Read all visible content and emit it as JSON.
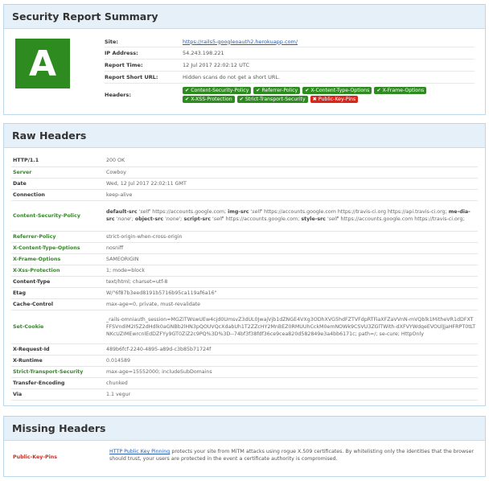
{
  "summary": {
    "title": "Security Report Summary",
    "grade": "A",
    "grade_color": "#2e8b1f",
    "rows": {
      "site_label": "Site:",
      "site_value": "https://rails5-googleoauth2.herokuapp.com/",
      "ip_label": "IP Address:",
      "ip_value": "54.243.198.221",
      "time_label": "Report Time:",
      "time_value": "12 Jul 2017 22:02:12 UTC",
      "short_label": "Report Short URL:",
      "short_value": "Hidden scans do not get a short URL.",
      "headers_label": "Headers:"
    },
    "badges": [
      {
        "label": "Content-Security-Policy",
        "status": "good",
        "icon": "check-icon"
      },
      {
        "label": "Referrer-Policy",
        "status": "good",
        "icon": "check-icon"
      },
      {
        "label": "X-Content-Type-Options",
        "status": "good",
        "icon": "check-icon"
      },
      {
        "label": "X-Frame-Options",
        "status": "good",
        "icon": "check-icon"
      },
      {
        "label": "X-XSS-Protection",
        "status": "good",
        "icon": "check-icon"
      },
      {
        "label": "Strict-Transport-Security",
        "status": "good",
        "icon": "check-icon"
      },
      {
        "label": "Public-Key-Pins",
        "status": "bad",
        "icon": "cross-icon"
      }
    ],
    "colors": {
      "good": "#2e8b1f",
      "bad": "#d9261c",
      "link": "#2a5db0",
      "panel_head": "#e6f0f8"
    }
  },
  "raw": {
    "title": "Raw Headers",
    "rows": [
      {
        "k": "HTTP/1.1",
        "v": "200 OK",
        "green": false
      },
      {
        "k": "Server",
        "v": "Cowboy",
        "green": true
      },
      {
        "k": "Date",
        "v": "Wed, 12 Jul 2017 22:02:11 GMT",
        "green": false
      },
      {
        "k": "Connection",
        "v": "keep-alive",
        "green": false
      },
      {
        "k": "Content-Security-Policy",
        "v": "",
        "green": true
      },
      {
        "k": "Referrer-Policy",
        "v": "strict-origin-when-cross-origin",
        "green": true
      },
      {
        "k": "X-Content-Type-Options",
        "v": "nosniff",
        "green": true
      },
      {
        "k": "X-Frame-Options",
        "v": "SAMEORIGIN",
        "green": true
      },
      {
        "k": "X-Xss-Protection",
        "v": "1; mode=block",
        "green": true
      },
      {
        "k": "Content-Type",
        "v": "text/html; charset=utf-8",
        "green": false
      },
      {
        "k": "Etag",
        "v": "W/\"6f87b3eed8191b5716b95ca119af6a16\"",
        "green": false
      },
      {
        "k": "Cache-Control",
        "v": "max-age=0, private, must-revalidate",
        "green": false
      },
      {
        "k": "Set-Cookie",
        "v": "_rails-omniauth_session=MGZiTWswUEw4cjd0UmsvZ3dUL0JwajVjb1dZNGE4VXg3ODhXVG5hdFZTVFdpRTFiaXFZaVVnN-mVQblk1MitheVR1dDFXTFFSVndiM2I5Z2dHdlk0aGNBb2lHN3pQOUVQcXdabUh1T2ZZcHY2MnBEZ0RMUUhCckM0emNOWk9CSVU3ZGlTWith-dXFVYWdqeEVOUlJjaHFRPT0tLTNKcUZIMEwrcnlEdDZFYy9GT0ZiZ2c9PQ%3D%3D--74bf3f38fdf36ce9cea820d582849e3a4bb6171c; path=/; se-cure; HttpOnly",
        "green": true
      },
      {
        "k": "X-Request-Id",
        "v": "489b6fcf-2240-4895-a89d-c3b85b71724f",
        "green": false
      },
      {
        "k": "X-Runtime",
        "v": "0.014589",
        "green": false
      },
      {
        "k": "Strict-Transport-Security",
        "v": "max-age=15552000; includeSubDomains",
        "green": true
      },
      {
        "k": "Transfer-Encoding",
        "v": "chunked",
        "green": false
      },
      {
        "k": "Via",
        "v": "1.1 vegur",
        "green": false
      }
    ],
    "csp": [
      {
        "kw": "default-src",
        "val": "'self'",
        "rest": "https://accounts.google.com;"
      },
      {
        "kw": "img-src",
        "val": "'self'",
        "rest": "https://accounts.google.com https://travis-ci.org https://api.travis-ci.org;"
      },
      {
        "kw": "me-dia-src",
        "val": "'none';",
        "rest": ""
      },
      {
        "kw": "object-src",
        "val": "'none';",
        "rest": ""
      },
      {
        "kw": "script-src",
        "val": "'self'",
        "rest": "https://accounts.google.com;"
      },
      {
        "kw": "style-src",
        "val": "'self'",
        "rest": "https://accounts.google.com https://travis-ci.org;"
      }
    ]
  },
  "missing": {
    "title": "Missing Headers",
    "rows": [
      {
        "k": "Public-Key-Pins",
        "link": "HTTP Public Key Pinning",
        "text": "protects your site from MiTM attacks using rogue X.509 certificates. By whitelisting only the identities that the browser should trust, your users are protected in the event a certificate authority is compromised."
      }
    ]
  }
}
